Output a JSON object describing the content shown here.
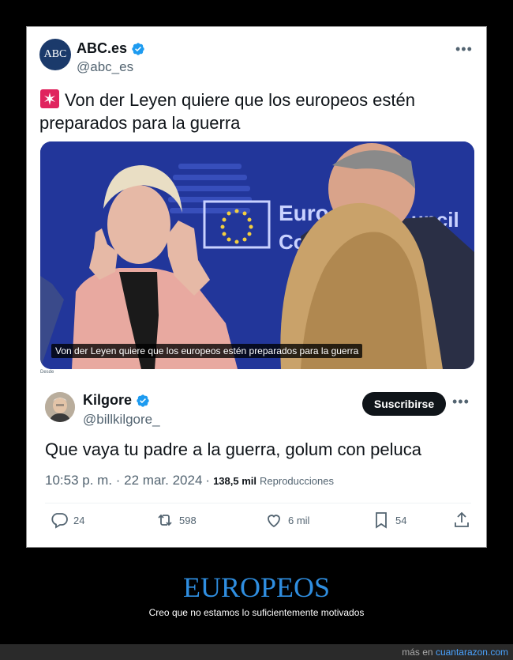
{
  "quoted": {
    "avatar_text": "ABC",
    "name": "ABC.es",
    "handle": "@abc_es",
    "more": "•••",
    "text": "Von der Leyen quiere que los europeos estén preparados para la guerra",
    "photo_caption": "Von der Leyen quiere que los europeos estén preparados para la guerra",
    "photo_banner": "European Council",
    "tiny_source": "Desde"
  },
  "reply": {
    "name": "Kilgore",
    "handle": "@billkilgore_",
    "subscribe_label": "Suscribirse",
    "more": "•••",
    "text": "Que vaya tu padre a la guerra, golum con peluca",
    "time": "10:53 p. m. · 22 mar. 2024",
    "views_count": "138,5 mil",
    "views_label": "Reproducciones",
    "actions": {
      "replies": "24",
      "retweets": "598",
      "likes": "6 mil",
      "bookmarks": "54"
    }
  },
  "caption": {
    "title": "EUROPEOS",
    "subtitle": "Creo que no estamos lo suficientemente motivados"
  },
  "footer": {
    "prefix": "más en",
    "link": "cuantarazon.com"
  },
  "colors": {
    "accent_blue": "#1d9bf0",
    "caption_blue": "#2f8ee0",
    "siren_red": "#e0245e"
  }
}
